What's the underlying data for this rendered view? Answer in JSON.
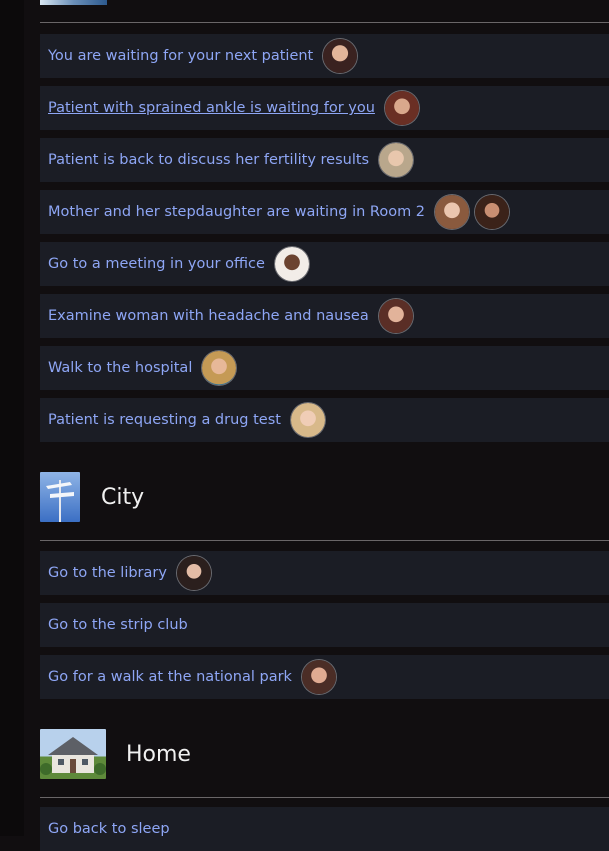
{
  "hospital": {
    "items": [
      {
        "label": "You are waiting for your next patient",
        "avatars": [
          "avatar-1"
        ]
      },
      {
        "label": "Patient with sprained ankle is waiting for you",
        "avatars": [
          "avatar-2"
        ]
      },
      {
        "label": "Patient is back to discuss her fertility results",
        "avatars": [
          "avatar-3"
        ]
      },
      {
        "label": "Mother and her stepdaughter are waiting in Room 2",
        "avatars": [
          "avatar-4",
          "avatar-5"
        ]
      },
      {
        "label": "Go to a meeting in your office",
        "avatars": [
          "avatar-6"
        ]
      },
      {
        "label": "Examine woman with headache and nausea",
        "avatars": [
          "avatar-7"
        ]
      },
      {
        "label": "Walk to the hospital",
        "avatars": [
          "avatar-8"
        ]
      },
      {
        "label": "Patient is requesting a drug test",
        "avatars": [
          "avatar-9"
        ]
      }
    ]
  },
  "city": {
    "title": "City",
    "items": [
      {
        "label": "Go to the library",
        "avatars": [
          "avatar-10"
        ]
      },
      {
        "label": "Go to the strip club",
        "avatars": []
      },
      {
        "label": "Go for a walk at the national park",
        "avatars": [
          "avatar-11"
        ]
      }
    ]
  },
  "home": {
    "title": "Home",
    "items": [
      {
        "label": "Go back to sleep",
        "avatars": []
      }
    ]
  },
  "colors": {
    "background": "#110e10",
    "row_background": "#1b1d25",
    "link_text": "#8ea6f5",
    "title_text": "#f0f0f0",
    "divider": "#6a6668"
  }
}
